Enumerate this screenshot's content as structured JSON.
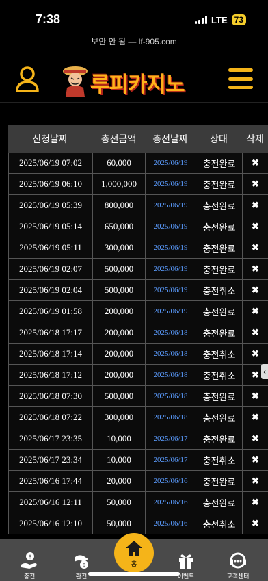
{
  "status_bar": {
    "time": "7:38",
    "network": "LTE",
    "battery": "73"
  },
  "url_bar": {
    "text": "보안 안 됨 — lf-905.com"
  },
  "header": {
    "logo_text": "루피카지노"
  },
  "table": {
    "headers": [
      "신청날짜",
      "충전금액",
      "충전날짜",
      "상태",
      "삭제"
    ],
    "rows": [
      {
        "request_date": "2025/06/19 07:02",
        "amount": "60,000",
        "charge_date": "2025/06/19",
        "status": "충전완료",
        "delete": "✖"
      },
      {
        "request_date": "2025/06/19 06:10",
        "amount": "1,000,000",
        "charge_date": "2025/06/19",
        "status": "충전완료",
        "delete": "✖"
      },
      {
        "request_date": "2025/06/19 05:39",
        "amount": "800,000",
        "charge_date": "2025/06/19",
        "status": "충전완료",
        "delete": "✖"
      },
      {
        "request_date": "2025/06/19 05:14",
        "amount": "650,000",
        "charge_date": "2025/06/19",
        "status": "충전완료",
        "delete": "✖"
      },
      {
        "request_date": "2025/06/19 05:11",
        "amount": "300,000",
        "charge_date": "2025/06/19",
        "status": "충전완료",
        "delete": "✖"
      },
      {
        "request_date": "2025/06/19 02:07",
        "amount": "500,000",
        "charge_date": "2025/06/19",
        "status": "충전완료",
        "delete": "✖"
      },
      {
        "request_date": "2025/06/19 02:04",
        "amount": "500,000",
        "charge_date": "2025/06/19",
        "status": "충전취소",
        "delete": "✖"
      },
      {
        "request_date": "2025/06/19 01:58",
        "amount": "200,000",
        "charge_date": "2025/06/19",
        "status": "충전완료",
        "delete": "✖"
      },
      {
        "request_date": "2025/06/18 17:17",
        "amount": "200,000",
        "charge_date": "2025/06/18",
        "status": "충전완료",
        "delete": "✖"
      },
      {
        "request_date": "2025/06/18 17:14",
        "amount": "200,000",
        "charge_date": "2025/06/18",
        "status": "충전취소",
        "delete": "✖"
      },
      {
        "request_date": "2025/06/18 17:12",
        "amount": "200,000",
        "charge_date": "2025/06/18",
        "status": "충전취소",
        "delete": "✖"
      },
      {
        "request_date": "2025/06/18 07:30",
        "amount": "500,000",
        "charge_date": "2025/06/18",
        "status": "충전완료",
        "delete": "✖"
      },
      {
        "request_date": "2025/06/18 07:22",
        "amount": "300,000",
        "charge_date": "2025/06/18",
        "status": "충전완료",
        "delete": "✖"
      },
      {
        "request_date": "2025/06/17 23:35",
        "amount": "10,000",
        "charge_date": "2025/06/17",
        "status": "충전완료",
        "delete": "✖"
      },
      {
        "request_date": "2025/06/17 23:34",
        "amount": "10,000",
        "charge_date": "2025/06/17",
        "status": "충전취소",
        "delete": "✖"
      },
      {
        "request_date": "2025/06/16 17:44",
        "amount": "20,000",
        "charge_date": "2025/06/16",
        "status": "충전완료",
        "delete": "✖"
      },
      {
        "request_date": "2025/06/16 12:11",
        "amount": "50,000",
        "charge_date": "2025/06/16",
        "status": "충전완료",
        "delete": "✖"
      },
      {
        "request_date": "2025/06/16 12:10",
        "amount": "50,000",
        "charge_date": "2025/06/16",
        "status": "충전취소",
        "delete": "✖"
      }
    ]
  },
  "bottom_nav": {
    "items": [
      {
        "label": "충전",
        "icon": "deposit-icon"
      },
      {
        "label": "환전",
        "icon": "withdraw-icon"
      },
      {
        "label": "홈",
        "icon": "home-icon"
      },
      {
        "label": "이벤트",
        "icon": "gift-icon"
      },
      {
        "label": "고객센터",
        "icon": "support-icon"
      }
    ]
  },
  "colors": {
    "accent": "#f5b419",
    "date_link": "#5b9cff",
    "nav_bg": "#4a4a4a",
    "header_bg": "#3b3b3b"
  }
}
